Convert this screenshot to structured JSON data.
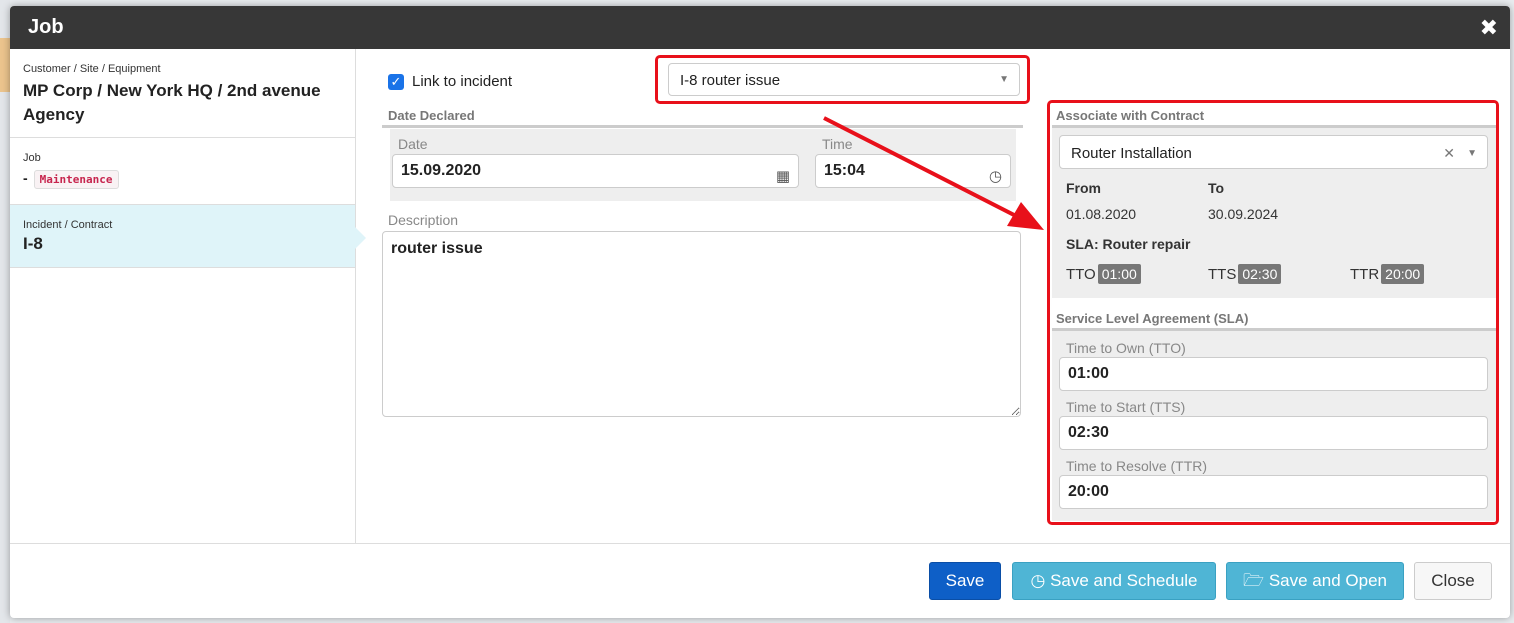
{
  "window": {
    "title": "Job",
    "close_glyph": "✖"
  },
  "sidebar": {
    "customer": {
      "label": "Customer / Site / Equipment",
      "value": "MP Corp / New York HQ / 2nd avenue Agency"
    },
    "job": {
      "label": "Job",
      "prefix": "-",
      "tag": "Maintenance"
    },
    "incident": {
      "label": "Incident / Contract",
      "value": "I-8"
    }
  },
  "form": {
    "link_checkbox": {
      "label": "Link to incident",
      "checked": true
    },
    "incident_select": {
      "value": "I-8 router issue"
    },
    "date_declared": {
      "title": "Date Declared",
      "date_label": "Date",
      "date_value": "15.09.2020",
      "time_label": "Time",
      "time_value": "15:04"
    },
    "description": {
      "label": "Description",
      "value": "router issue"
    }
  },
  "contract": {
    "title": "Associate with Contract",
    "select_value": "Router Installation",
    "from_label": "From",
    "from_value": "01.08.2020",
    "to_label": "To",
    "to_value": "30.09.2024",
    "sla_title": "SLA: Router repair",
    "tto_label": "TTO",
    "tto_value": "01:00",
    "tts_label": "TTS",
    "tts_value": "02:30",
    "ttr_label": "TTR",
    "ttr_value": "20:00"
  },
  "sla": {
    "title": "Service Level Agreement (SLA)",
    "tto_label": "Time to Own (TTO)",
    "tto_value": "01:00",
    "tts_label": "Time to Start (TTS)",
    "tts_value": "02:30",
    "ttr_label": "Time to Resolve (TTR)",
    "ttr_value": "20:00"
  },
  "footer": {
    "save": "Save",
    "save_schedule": "Save and Schedule",
    "save_open": "Save and Open",
    "close": "Close"
  },
  "colors": {
    "header": "#373737",
    "primary": "#0e5fc7",
    "info": "#4fb5d5",
    "highlight": "#e8101a",
    "active_nav": "#dff4f9"
  }
}
